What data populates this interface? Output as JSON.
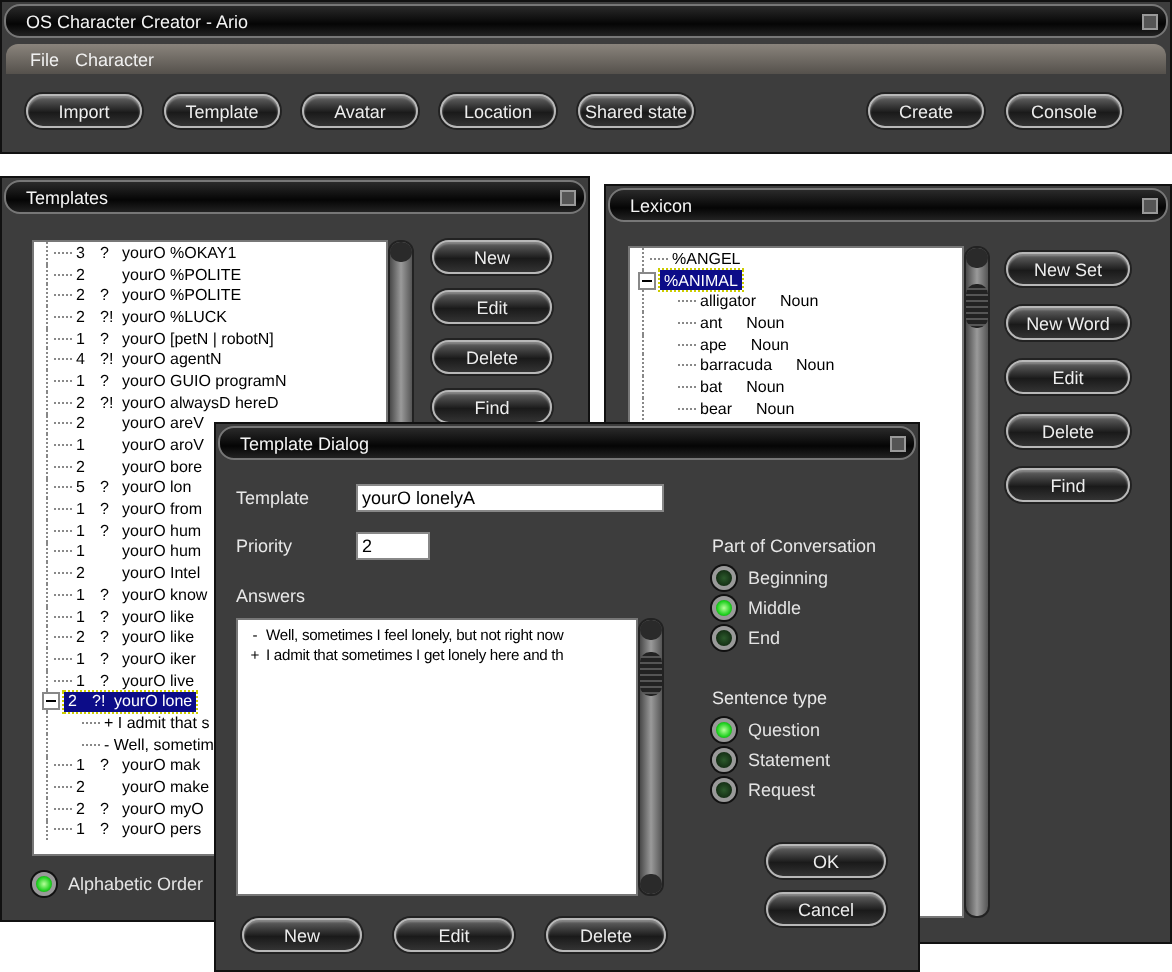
{
  "app_window": {
    "title": "OS Character Creator - Ario",
    "menu": [
      "File",
      "Character"
    ],
    "toolbar_buttons": [
      "Import",
      "Template",
      "Avatar",
      "Location",
      "Shared state"
    ],
    "right_buttons": [
      "Create",
      "Console"
    ]
  },
  "templates": {
    "title": "Templates",
    "items": [
      {
        "count": "3",
        "mark": "?",
        "text": "yourO %OKAY1",
        "selected": false
      },
      {
        "count": "2",
        "text": "yourO %POLITE",
        "selected": false
      },
      {
        "count": "2",
        "mark": "?",
        "text": "yourO %POLITE",
        "selected": false
      },
      {
        "count": "2",
        "mark": "?!",
        "text": "yourO %LUCK",
        "selected": false
      },
      {
        "count": "1",
        "mark": "?",
        "text": "yourO [petN | robotN]",
        "selected": false
      },
      {
        "count": "4",
        "mark": "?!",
        "text": "yourO agentN",
        "selected": false
      },
      {
        "count": "1",
        "mark": "?",
        "text": "yourO GUIO programN",
        "selected": false
      },
      {
        "count": "2",
        "mark": "?!",
        "text": "yourO alwaysD hereD",
        "selected": false
      },
      {
        "count": "2",
        "text": "yourO areV",
        "selected": false
      },
      {
        "count": "1",
        "text": "yourO aroV",
        "selected": false
      },
      {
        "count": "2",
        "text": "yourO bore",
        "selected": false
      },
      {
        "count": "5",
        "mark": "?",
        "text": "yourO lon",
        "selected": false
      },
      {
        "count": "1",
        "mark": "?",
        "text": "yourO from",
        "selected": false
      },
      {
        "count": "1",
        "mark": "?",
        "text": "yourO hum",
        "selected": false
      },
      {
        "count": "1",
        "text": "yourO hum",
        "selected": false
      },
      {
        "count": "2",
        "text": "yourO Intel",
        "selected": false
      },
      {
        "count": "1",
        "mark": "?",
        "text": "yourO know",
        "selected": false
      },
      {
        "count": "1",
        "mark": "?",
        "text": "yourO like",
        "selected": false
      },
      {
        "count": "2",
        "mark": "?",
        "text": "yourO like",
        "selected": false
      },
      {
        "count": "1",
        "mark": "?",
        "text": "yourO iker",
        "selected": false
      },
      {
        "count": "1",
        "mark": "?",
        "text": "yourO live",
        "selected": false
      },
      {
        "count": "2",
        "mark": "?!",
        "text": "yourO lone",
        "selected": true,
        "expanded": true,
        "children": [
          {
            "text": "+ I admit that s",
            "selected": false
          },
          {
            "text": "- Well, sometim",
            "selected": false
          }
        ]
      },
      {
        "count": "1",
        "mark": "?",
        "text": "yourO mak",
        "selected": false
      },
      {
        "count": "2",
        "text": "yourO make",
        "selected": false
      },
      {
        "count": "2",
        "mark": "?",
        "text": "yourO myO",
        "selected": false
      },
      {
        "count": "1",
        "mark": "?",
        "text": "yourO pers",
        "selected": false
      }
    ],
    "buttons": [
      "New",
      "Edit",
      "Delete",
      "Find"
    ],
    "order_option": {
      "label": "Alphabetic Order",
      "selected": true
    }
  },
  "lexicon": {
    "title": "Lexicon",
    "items": [
      {
        "text": "%ANGEL",
        "selected": false
      },
      {
        "text": "%ANIMAL",
        "selected": true,
        "expanded": true,
        "children": [
          {
            "word": "alligator",
            "type": "Noun",
            "selected": false
          },
          {
            "word": "ant",
            "type": "Noun",
            "selected": false
          },
          {
            "word": "ape",
            "type": "Noun",
            "selected": false
          },
          {
            "word": "barracuda",
            "type": "Noun",
            "selected": false
          },
          {
            "word": "bat",
            "type": "Noun",
            "selected": false
          },
          {
            "word": "bear",
            "type": "Noun",
            "selected": false
          }
        ]
      }
    ],
    "buttons": [
      "New Set",
      "New Word",
      "Edit",
      "Delete",
      "Find"
    ]
  },
  "template_dialog": {
    "title": "Template Dialog",
    "template_label": "Template",
    "template_value": "yourO lonelyA",
    "priority_label": "Priority",
    "priority_value": "2",
    "answers_label": "Answers",
    "answers": [
      {
        "sign": "-",
        "text": "Well, sometimes I feel lonely, but not right now"
      },
      {
        "sign": "+",
        "text": "I admit that sometimes I get lonely here and th"
      }
    ],
    "buttons": [
      "New",
      "Edit",
      "Delete"
    ],
    "part_of_conversation": {
      "label": "Part of Conversation",
      "options": [
        {
          "label": "Beginning",
          "selected": false
        },
        {
          "label": "Middle",
          "selected": true
        },
        {
          "label": "End",
          "selected": false
        }
      ]
    },
    "sentence_type": {
      "label": "Sentence type",
      "options": [
        {
          "label": "Question",
          "selected": true
        },
        {
          "label": "Statement",
          "selected": false
        },
        {
          "label": "Request",
          "selected": false
        }
      ]
    },
    "ok": "OK",
    "cancel": "Cancel"
  }
}
